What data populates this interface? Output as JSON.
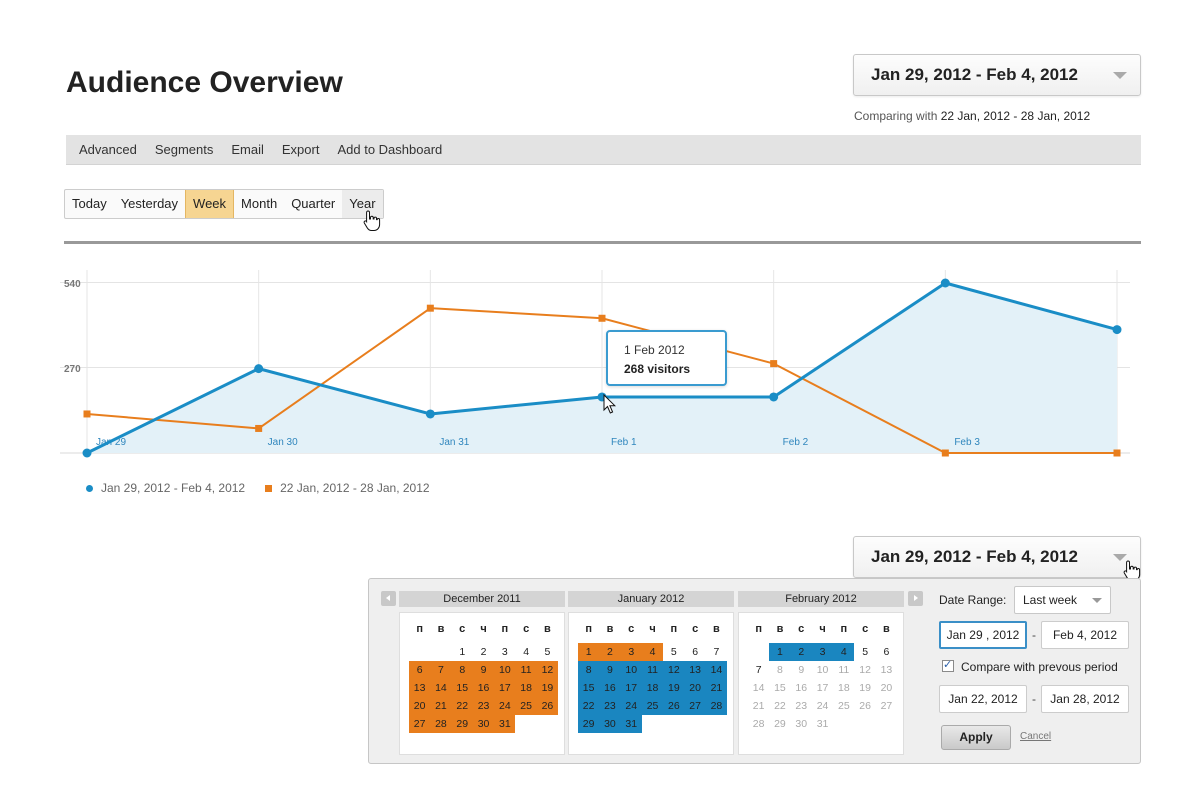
{
  "page": {
    "title": "Audience Overview"
  },
  "header": {
    "date_range": "Jan 29, 2012 - Feb 4, 2012",
    "comparing_prefix": "Comparing with ",
    "comparing_range": "22 Jan, 2012 - 28 Jan, 2012"
  },
  "toolbar": {
    "items": [
      "Advanced",
      "Segments",
      "Email",
      "Export",
      "Add to Dashboard"
    ]
  },
  "periods": {
    "items": [
      "Today",
      "Yesterday",
      "Week",
      "Month",
      "Quarter",
      "Year"
    ],
    "selected": "Week",
    "hovered": "Year"
  },
  "chart_data": {
    "type": "line",
    "categories": [
      "Jan 29",
      "Jan 30",
      "Jan 31",
      "Feb 1",
      "Feb 2",
      "Feb 3",
      "Feb 4"
    ],
    "y_ticks": [
      540,
      270
    ],
    "ylim": [
      0,
      540
    ],
    "series": [
      {
        "name": "Jan 29, 2012 - Feb 4, 2012",
        "color": "#1a8dc6",
        "area": true,
        "marker": "circle",
        "values": [
          0,
          268,
          124,
          178,
          178,
          540,
          392
        ]
      },
      {
        "name": "22 Jan, 2012 - 28 Jan, 2012",
        "color": "#e87e1d",
        "area": false,
        "marker": "square",
        "values": [
          124,
          78,
          460,
          428,
          284,
          0,
          0
        ]
      }
    ],
    "tooltip": {
      "date": "1 Feb 2012",
      "value": "268 visitors"
    }
  },
  "picker": {
    "trigger_label": "Jan 29, 2012 - Feb 4, 2012",
    "weekday_headers": [
      "п",
      "в",
      "с",
      "ч",
      "п",
      "с",
      "в"
    ],
    "months": [
      {
        "title": "December 2011",
        "offset": 2,
        "days": 31,
        "highlight": "orange",
        "range": [
          6,
          31
        ],
        "muted": false
      },
      {
        "title": "January 2012",
        "offset": 0,
        "days": 31,
        "highlight": "mixed",
        "orange": [
          1,
          4
        ],
        "blue": [
          8,
          31
        ],
        "muted": false
      },
      {
        "title": "February 2012",
        "offset": 1,
        "days": 31,
        "highlight": "blue",
        "range": [
          1,
          4
        ],
        "muted_after": 7
      }
    ],
    "date_range_label": "Date Range:",
    "date_range_option": "Last week",
    "from": "Jan 29 , 2012",
    "to": "Feb 4, 2012",
    "compare_label": "Compare with prevous period",
    "compare_from": "Jan 22, 2012",
    "compare_to": "Jan 28, 2012",
    "apply_label": "Apply",
    "cancel_label": "Cancel"
  }
}
